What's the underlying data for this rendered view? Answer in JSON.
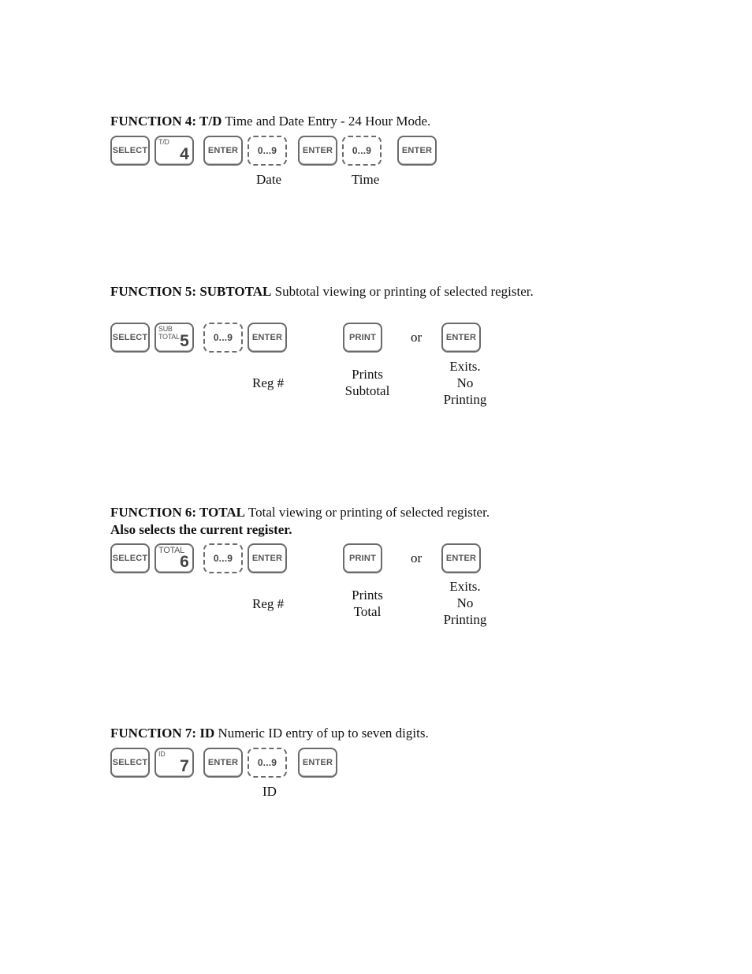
{
  "functions": [
    {
      "id": "f4",
      "heading_bold": "FUNCTION 4: T/D",
      "heading_text": " Time and Date Entry - 24 Hour Mode.",
      "keys": {
        "select": "SELECT",
        "func_top": "T/D",
        "func_num": "4",
        "enter1": "ENTER",
        "digits1": "0...9",
        "enter2": "ENTER",
        "digits2": "0...9",
        "enter3": "ENTER"
      },
      "labels": {
        "date": "Date",
        "time": "Time"
      }
    },
    {
      "id": "f5",
      "heading_bold": "FUNCTION 5: SUBTOTAL",
      "heading_text": " Subtotal viewing or printing of selected register.",
      "keys": {
        "select": "SELECT",
        "func_top": "SUB TOTAL",
        "func_num": "5",
        "digits": "0...9",
        "enter1": "ENTER",
        "print": "PRINT",
        "enter2": "ENTER"
      },
      "or": "or",
      "labels": {
        "reg": "Reg #",
        "prints_1": "Prints",
        "prints_2": "Subtotal",
        "exits_1": "Exits.",
        "exits_2": "No",
        "exits_3": "Printing"
      }
    },
    {
      "id": "f6",
      "heading_bold": "FUNCTION 6: TOTAL",
      "heading_text": " Total viewing or printing of selected register.",
      "heading_line2_bold": "Also selects the current register.",
      "keys": {
        "select": "SELECT",
        "func_top": "TOTAL",
        "func_num": "6",
        "digits": "0...9",
        "enter1": "ENTER",
        "print": "PRINT",
        "enter2": "ENTER"
      },
      "or": "or",
      "labels": {
        "reg": "Reg #",
        "prints_1": "Prints",
        "prints_2": "Total",
        "exits_1": "Exits.",
        "exits_2": "No",
        "exits_3": "Printing"
      }
    },
    {
      "id": "f7",
      "heading_bold": "FUNCTION 7: ID",
      "heading_text": " Numeric ID entry of up to seven digits.",
      "keys": {
        "select": "SELECT",
        "func_top": "ID",
        "func_num": "7",
        "enter1": "ENTER",
        "digits": "0...9",
        "enter2": "ENTER"
      },
      "labels": {
        "id": "ID"
      }
    }
  ]
}
